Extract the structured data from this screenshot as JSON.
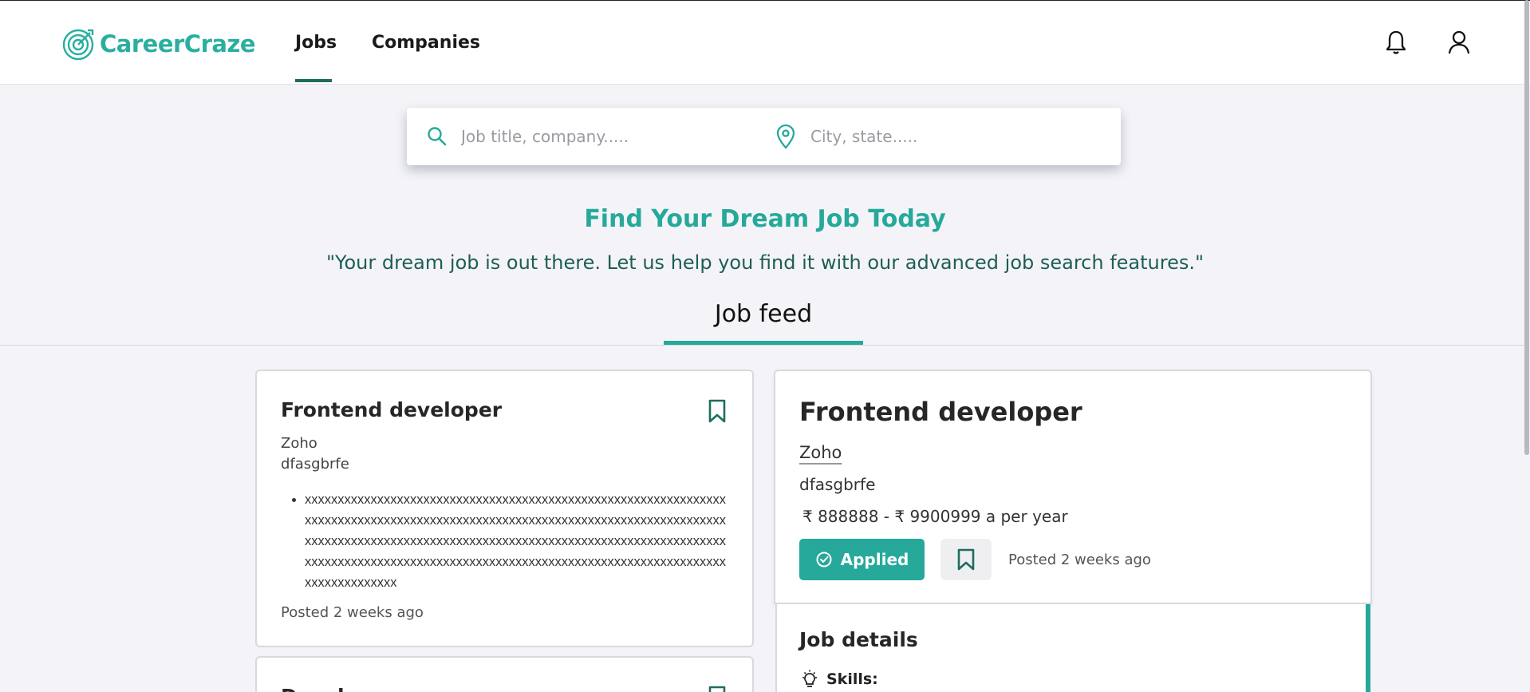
{
  "brand": {
    "name": "CareerCraze",
    "color": "#2aae9f"
  },
  "nav": {
    "jobs": "Jobs",
    "companies": "Companies",
    "active": "Jobs"
  },
  "header_icons": {
    "notifications": "bell-icon",
    "profile": "user-icon"
  },
  "search": {
    "query_placeholder": "Job title, company.....",
    "query_value": "",
    "location_placeholder": "City, state.....",
    "location_value": ""
  },
  "hero": {
    "title": "Find Your Dream Job Today",
    "quote": "\"Your dream job is out there. Let us help you find it with our advanced job search features.\""
  },
  "feed": {
    "tab": "Job feed"
  },
  "jobs": [
    {
      "title": "Frontend developer",
      "company": "Zoho",
      "location": "dfasgbrfe",
      "description": "xxxxxxxxxxxxxxxxxxxxxxxxxxxxxxxxxxxxxxxxxxxxxxxxxxxxxxxxxxxxxxxxxxxxxxxxxxxxxxxxxxxxxxxxxxxxxxxxxxxxxxxxxxxxxxxxxxxxxxxxxxxxxxxxxxxxxxxxxxxxxxxxxxxxxxxxxxxxxxxxxxxxxxxxxxxxxxxxxxxxxxxxxxxxxxxxxxxxxxxxxxxxxxxxxxxxxxxxxxxxxxxxxxxxxxxxxxxxxxxxxxxxxxxxxxxxxxxxxxxxxxxxxxxxxx",
      "posted": "Posted 2 weeks ago"
    },
    {
      "title": "Developer"
    }
  ],
  "detail": {
    "title": "Frontend developer",
    "company": "Zoho",
    "location": "dfasgbrfe",
    "salary": "₹ 888888 - ₹ 9900999 a per year",
    "applied_label": "Applied",
    "posted": "Posted 2 weeks ago",
    "details_heading": "Job details",
    "skills_label": "Skills:"
  },
  "colors": {
    "accent": "#26a99a",
    "dark_accent": "#1f6d5f",
    "background": "#f4f4f8"
  }
}
